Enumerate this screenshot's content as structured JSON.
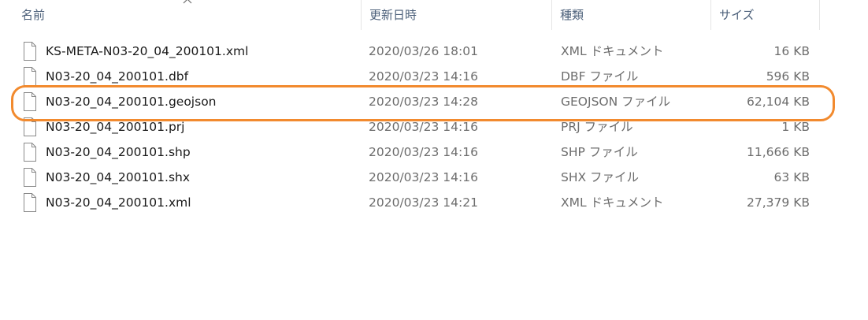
{
  "columns": {
    "name": "名前",
    "date": "更新日時",
    "type": "種類",
    "size": "サイズ"
  },
  "sort_indicator": "chevron-up-icon",
  "files": [
    {
      "name": "KS-META-N03-20_04_200101.xml",
      "date": "2020/03/26 18:01",
      "type": "XML ドキュメント",
      "size": "16 KB"
    },
    {
      "name": "N03-20_04_200101.dbf",
      "date": "2020/03/23 14:16",
      "type": "DBF ファイル",
      "size": "596 KB"
    },
    {
      "name": "N03-20_04_200101.geojson",
      "date": "2020/03/23 14:28",
      "type": "GEOJSON ファイル",
      "size": "62,104 KB",
      "highlighted": true
    },
    {
      "name": "N03-20_04_200101.prj",
      "date": "2020/03/23 14:16",
      "type": "PRJ ファイル",
      "size": "1 KB"
    },
    {
      "name": "N03-20_04_200101.shp",
      "date": "2020/03/23 14:16",
      "type": "SHP ファイル",
      "size": "11,666 KB"
    },
    {
      "name": "N03-20_04_200101.shx",
      "date": "2020/03/23 14:16",
      "type": "SHX ファイル",
      "size": "63 KB"
    },
    {
      "name": "N03-20_04_200101.xml",
      "date": "2020/03/23 14:21",
      "type": "XML ドキュメント",
      "size": "27,379 KB"
    }
  ],
  "colors": {
    "highlight_border": "#f28a2e",
    "header_text": "#4c607a",
    "secondary_text": "#6d6d6d"
  }
}
